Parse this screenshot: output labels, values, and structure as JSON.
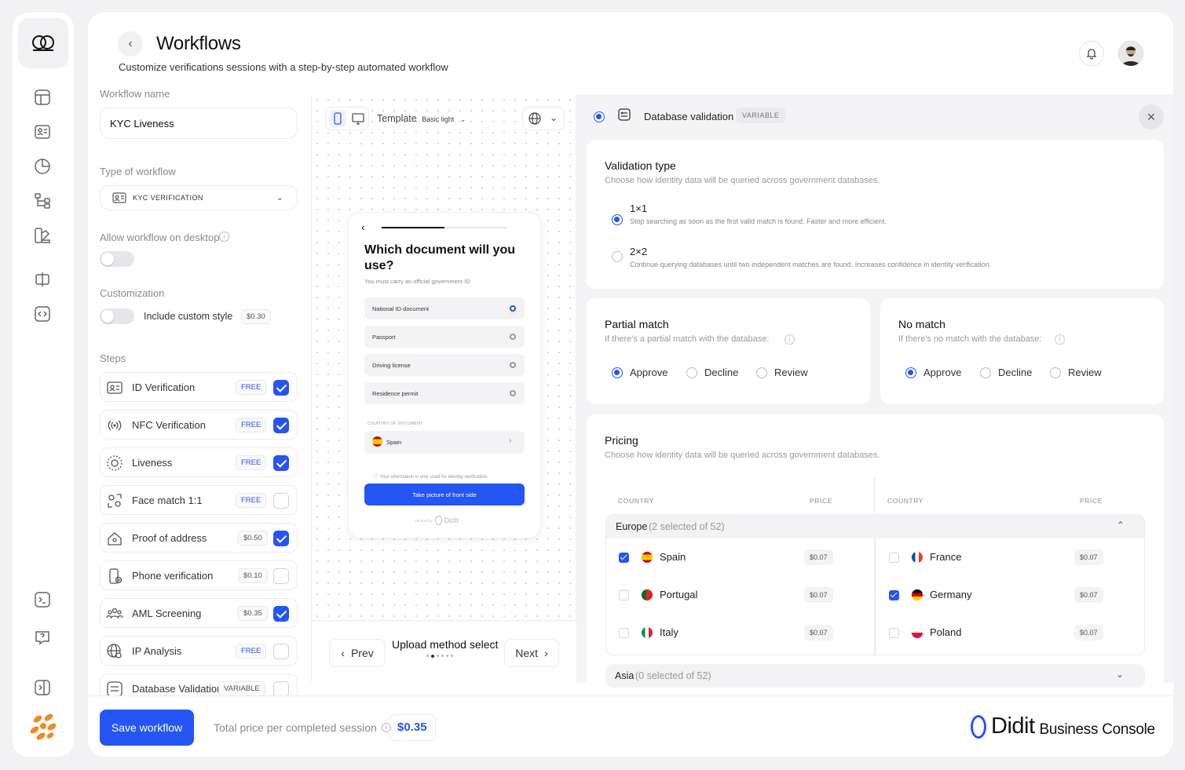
{
  "header": {
    "title": "Workflows",
    "subtitle": "Customize verifications sessions with a step-by-step automated workflow"
  },
  "form": {
    "name_label": "Workflow name",
    "name_value": "KYC Liveness",
    "type_label": "Type of workflow",
    "type_value": "KYC VERIFICATION",
    "desktop_label": "Allow workflow on desktop",
    "custom_label": "Customization",
    "custom_toggle": "Include custom style",
    "custom_price": "$0.30",
    "steps_label": "Steps",
    "steps": [
      {
        "name": "ID Verification",
        "price": "FREE",
        "checked": true
      },
      {
        "name": "NFC Verification",
        "price": "FREE",
        "checked": true
      },
      {
        "name": "Liveness",
        "price": "FREE",
        "checked": true
      },
      {
        "name": "Face match 1:1",
        "price": "FREE",
        "checked": false
      },
      {
        "name": "Proof of address",
        "price": "$0.50",
        "checked": true
      },
      {
        "name": "Phone verification",
        "price": "$0.10",
        "checked": false
      },
      {
        "name": "AML Screening",
        "price": "$0.35",
        "checked": true
      },
      {
        "name": "IP Analysis",
        "price": "FREE",
        "checked": false
      },
      {
        "name": "Database Validation",
        "price": "VARIABLE",
        "checked": false
      }
    ]
  },
  "preview": {
    "template_label": "Template",
    "template_value": "Basic light",
    "question": "Which document will you use?",
    "hint": "You must carry an official government ID",
    "options": [
      "National ID document",
      "Passport",
      "Driving license",
      "Residence permit"
    ],
    "country_label": "COUNTRY OF DOCUMENT",
    "country": "Spain",
    "privacy": "Your information is only used for identity verification.",
    "cta": "Take picture of front side",
    "secured": "Secured by",
    "brand": "Didit",
    "prev": "Prev",
    "next": "Next",
    "step_title": "Upload method select"
  },
  "panel": {
    "title": "Database validation",
    "badge": "VARIABLE",
    "validation": {
      "title": "Validation type",
      "sub": "Choose how identity data will be queried across government databases.",
      "opt1": "1×1",
      "opt1_desc": "Stop searching as soon as the first valid match is found. Faster and more efficient.",
      "opt2": "2×2",
      "opt2_desc": "Continue querying databases until two independent matches are found. Increases confidence in identity verification."
    },
    "partial": {
      "title": "Partial match",
      "sub": "If there's a partial match with the database:",
      "approve": "Approve",
      "decline": "Decline",
      "review": "Review"
    },
    "nomatch": {
      "title": "No match",
      "sub": "If there's no match with the database:",
      "approve": "Approve",
      "decline": "Decline",
      "review": "Review"
    },
    "pricing": {
      "title": "Pricing",
      "sub": "Choose how identity data will be queried across government databases.",
      "col_country": "COUNTRY",
      "col_price": "PRICE",
      "europe": "Europe",
      "europe_count": "(2 selected of 52)",
      "asia": "Asia",
      "asia_count": "(0 selected of 52)",
      "left": [
        {
          "name": "Spain",
          "price": "$0.07",
          "checked": true
        },
        {
          "name": "Portugal",
          "price": "$0.07",
          "checked": false
        },
        {
          "name": "Italy",
          "price": "$0.07",
          "checked": false
        }
      ],
      "right": [
        {
          "name": "France",
          "price": "$0.07",
          "checked": false
        },
        {
          "name": "Germany",
          "price": "$0.07",
          "checked": true
        },
        {
          "name": "Poland",
          "price": "$0.07",
          "checked": false
        }
      ]
    }
  },
  "footer": {
    "save": "Save workflow",
    "total_label": "Total price per completed session",
    "total": "$0.35",
    "brand": "Didit",
    "brand_sub": "Business Console"
  },
  "colors": {
    "accent": "#2555f5",
    "background": "#f2f2f4"
  }
}
